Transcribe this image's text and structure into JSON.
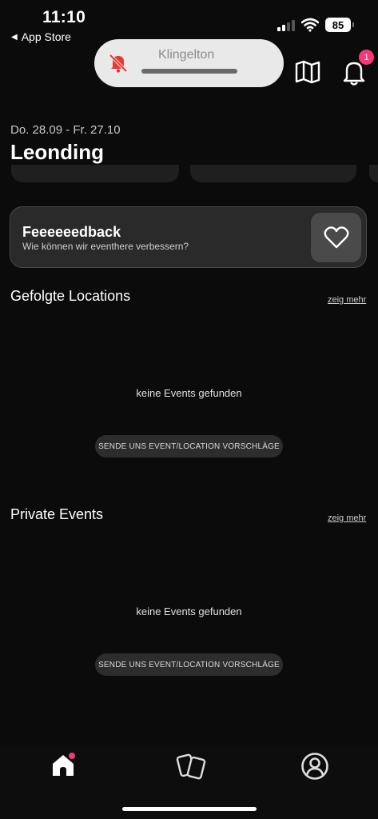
{
  "status_bar": {
    "time": "11:10",
    "back_label": "App Store",
    "battery": "85"
  },
  "ringer": {
    "label": "Klingelton",
    "icon": "bell-slash-icon",
    "icon_color": "#e53935"
  },
  "header": {
    "notification_count": "1",
    "badge_color": "#f5387a"
  },
  "location": {
    "date_range": "Do. 28.09 - Fr. 27.10",
    "city": "Leonding"
  },
  "feedback": {
    "title": "Feeeeeedback",
    "subtitle": "Wie können wir eventhere verbessern?"
  },
  "sections": [
    {
      "title": "Gefolgte Locations",
      "more": "zeig mehr",
      "empty_text": "keine Events gefunden",
      "suggest_button": "SENDE UNS EVENT/LOCATION VORSCHLÄGE"
    },
    {
      "title": "Private Events",
      "more": "zeig mehr",
      "empty_text": "keine Events gefunden",
      "suggest_button": "SENDE UNS EVENT/LOCATION VORSCHLÄGE"
    }
  ],
  "tabs": [
    "home-icon",
    "cards-icon",
    "profile-icon"
  ]
}
